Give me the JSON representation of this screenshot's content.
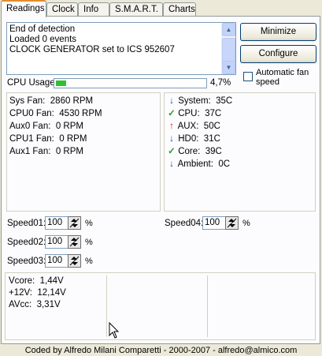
{
  "tabs": [
    "Readings",
    "Clock",
    "Info",
    "S.M.A.R.T.",
    "Charts"
  ],
  "log": {
    "lines": [
      "End of detection",
      "Loaded 0 events",
      "CLOCK GENERATOR set to ICS 952607"
    ]
  },
  "buttons": {
    "minimize": "Minimize",
    "configure": "Configure"
  },
  "auto_fan": {
    "label": "Automatic fan speed",
    "checked": false
  },
  "cpu": {
    "label": "CPU Usage",
    "value": "4,7%",
    "fraction": 0.047
  },
  "fans": [
    {
      "label": "Sys Fan:",
      "value": "2860 RPM"
    },
    {
      "label": "CPU0 Fan:",
      "value": "4530 RPM"
    },
    {
      "label": "Aux0 Fan:",
      "value": "0 RPM"
    },
    {
      "label": "CPU1 Fan:",
      "value": "0 RPM"
    },
    {
      "label": "Aux1 Fan:",
      "value": "0 RPM"
    }
  ],
  "temps": [
    {
      "label": "System:",
      "value": "35C",
      "icon": "down-arrow-icon",
      "color": "#1a3fd0"
    },
    {
      "label": "CPU:",
      "value": "37C",
      "icon": "check-icon",
      "color": "#2e9b2e"
    },
    {
      "label": "AUX:",
      "value": "50C",
      "icon": "up-arrow-icon",
      "color": "#d42020"
    },
    {
      "label": "HD0:",
      "value": "31C",
      "icon": "down-arrow-icon",
      "color": "#1a3fd0"
    },
    {
      "label": "Core:",
      "value": "39C",
      "icon": "check-icon",
      "color": "#2e9b2e"
    },
    {
      "label": "Ambient:",
      "value": "0C",
      "icon": "down-arrow-icon",
      "color": "#1a3fd0"
    }
  ],
  "speeds": [
    {
      "label": "Speed01:",
      "value": "100"
    },
    {
      "label": "Speed02:",
      "value": "100"
    },
    {
      "label": "Speed03:",
      "value": "100"
    },
    {
      "label": "Speed04:",
      "value": "100"
    }
  ],
  "speed_unit": "%",
  "voltages": [
    {
      "label": "Vcore:",
      "value": "1,44V"
    },
    {
      "label": "+12V:",
      "value": "12,14V"
    },
    {
      "label": "AVcc:",
      "value": "3,31V"
    }
  ],
  "footer": "Coded by Alfredo Milani Comparetti - 2000-2007 - alfredo@almico.com"
}
